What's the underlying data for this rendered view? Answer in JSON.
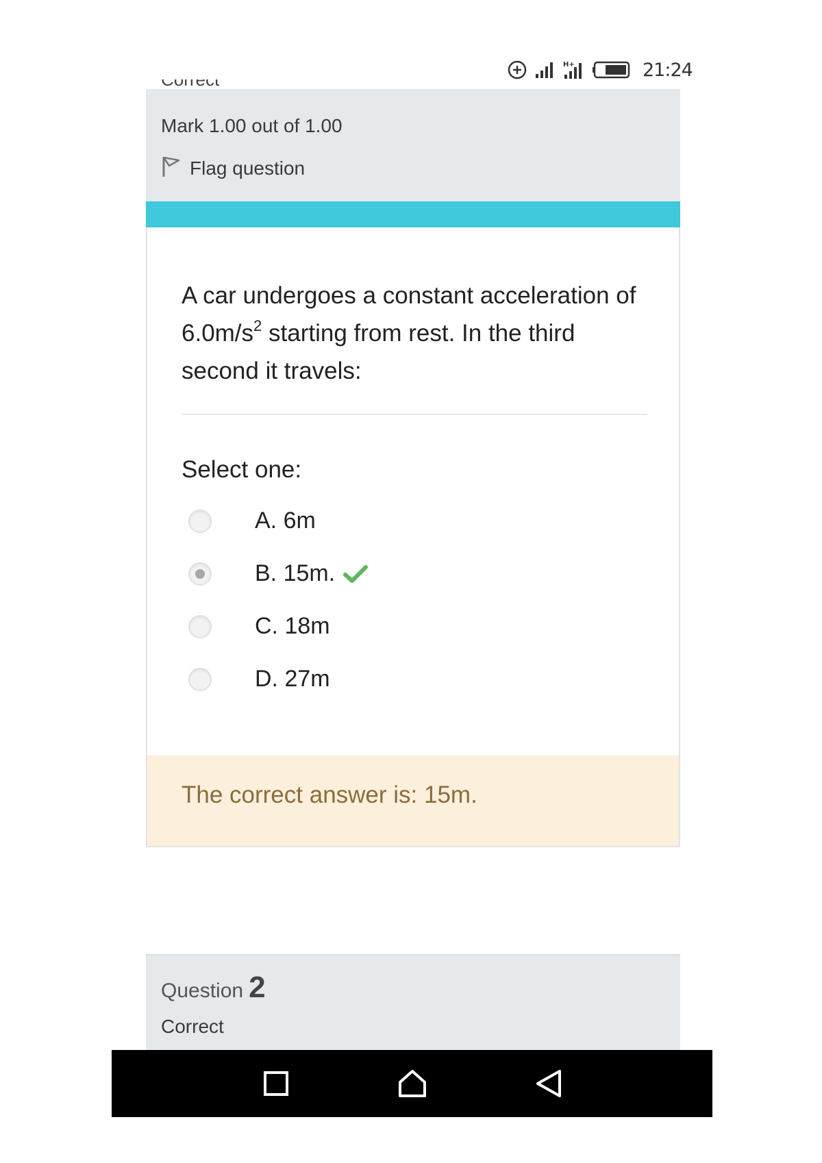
{
  "status_bar": {
    "icons": [
      "add-circle-icon",
      "signal-icon",
      "signal-hplus-icon",
      "battery-icon"
    ],
    "time": "21:24"
  },
  "question1": {
    "state_clipped": "Correct",
    "mark": "Mark 1.00 out of 1.00",
    "flag_label": "Flag question",
    "text_before_sup": "A car undergoes a constant acceleration of 6.0m/s",
    "text_sup": "2",
    "text_after_sup": " starting from rest. In the third second it travels:",
    "prompt": "Select one:",
    "answers": [
      {
        "label": "A. 6m",
        "selected": false
      },
      {
        "label": "B. 15m.",
        "selected": true,
        "correct_mark": "check-icon"
      },
      {
        "label": "C. 18m",
        "selected": false
      },
      {
        "label": "D. 27m",
        "selected": false
      }
    ],
    "feedback": "The correct answer is: 15m."
  },
  "question2": {
    "word": "Question",
    "number": "2",
    "state": "Correct"
  },
  "nav_bar": {
    "buttons": [
      "recent-apps-icon",
      "home-icon",
      "back-icon"
    ]
  },
  "colors": {
    "accent": "#40c8dd",
    "info_panel": "#e6e9ec",
    "feedback_bg": "#fcefdc",
    "feedback_text": "#8a6d3b",
    "check": "#5cb85c"
  }
}
